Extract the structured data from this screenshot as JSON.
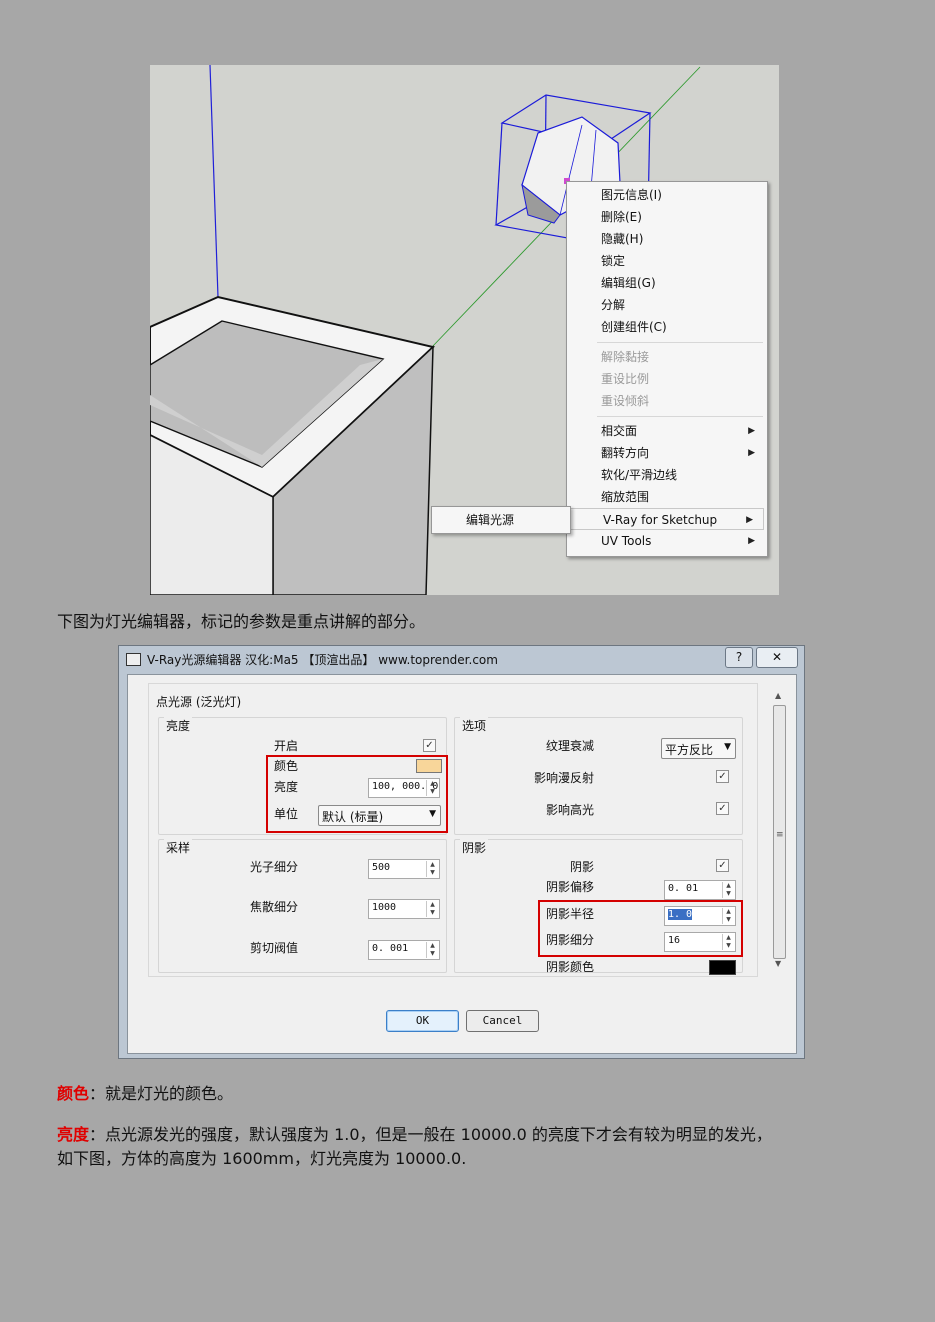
{
  "context_menu": {
    "group1": [
      "图元信息(I)",
      "删除(E)",
      "隐藏(H)",
      "锁定",
      "编辑组(G)",
      "分解",
      "创建组件(C)"
    ],
    "group2_disabled": [
      "解除黏接",
      "重设比例",
      "重设倾斜"
    ],
    "group3": [
      {
        "label": "相交面",
        "submenu": true
      },
      {
        "label": "翻转方向",
        "submenu": true
      },
      {
        "label": "软化/平滑边线",
        "submenu": false
      },
      {
        "label": "缩放范围",
        "submenu": false
      },
      {
        "label": "V-Ray for Sketchup",
        "submenu": true
      },
      {
        "label": "UV Tools",
        "submenu": true
      }
    ],
    "submenu_item": "编辑光源",
    "arrow_glyph": "▶"
  },
  "caption": "下图为灯光编辑器，标记的参数是重点讲解的部分。",
  "dialog": {
    "title": "V-Ray光源编辑器    汉化:Ma5    【顶渲出品】 www.toprender.com",
    "help_button": "?",
    "close_button": "✕",
    "outer_group": "点光源 (泛光灯)",
    "brightness": {
      "title": "亮度",
      "on_label": "开启",
      "color_label": "颜色",
      "intensity_label": "亮度",
      "intensity_value": "100, 000. 0",
      "unit_label": "单位",
      "unit_value": "默认 (标量)"
    },
    "options": {
      "title": "选项",
      "decay_label": "纹理衰减",
      "decay_value": "平方反比",
      "diffuse_label": "影响漫反射",
      "specular_label": "影响高光"
    },
    "sampling": {
      "title": "采样",
      "photon_label": "光子细分",
      "photon_value": "500",
      "caustic_label": "焦散细分",
      "caustic_value": "1000",
      "cutoff_label": "剪切阀值",
      "cutoff_value": "0. 001"
    },
    "shadow": {
      "title": "阴影",
      "shadow_label": "阴影",
      "bias_label": "阴影偏移",
      "bias_value": "0. 01",
      "radius_label": "阴影半径",
      "radius_value": "1. 0",
      "subdiv_label": "阴影细分",
      "subdiv_value": "16",
      "color_label": "阴影颜色"
    },
    "ok": "OK",
    "cancel": "Cancel",
    "check_glyph": "✓",
    "color_swatch": "#f8d69a",
    "shadow_color": "#000000"
  },
  "paragraphs": {
    "color_kw": "颜色",
    "color_text": "：就是灯光的颜色。",
    "bright_kw": "亮度",
    "bright_text_1": "：点光源发光的强度，默认强度为 1.0，但是一般在 10000.0 的亮度下才会有较为明显的发光，",
    "bright_text_2": "如下图，方体的高度为 1600mm，灯光亮度为 10000.0."
  },
  "colors": {
    "highlight_red": "#e00000",
    "accent_blue": "#3b7fc8"
  }
}
